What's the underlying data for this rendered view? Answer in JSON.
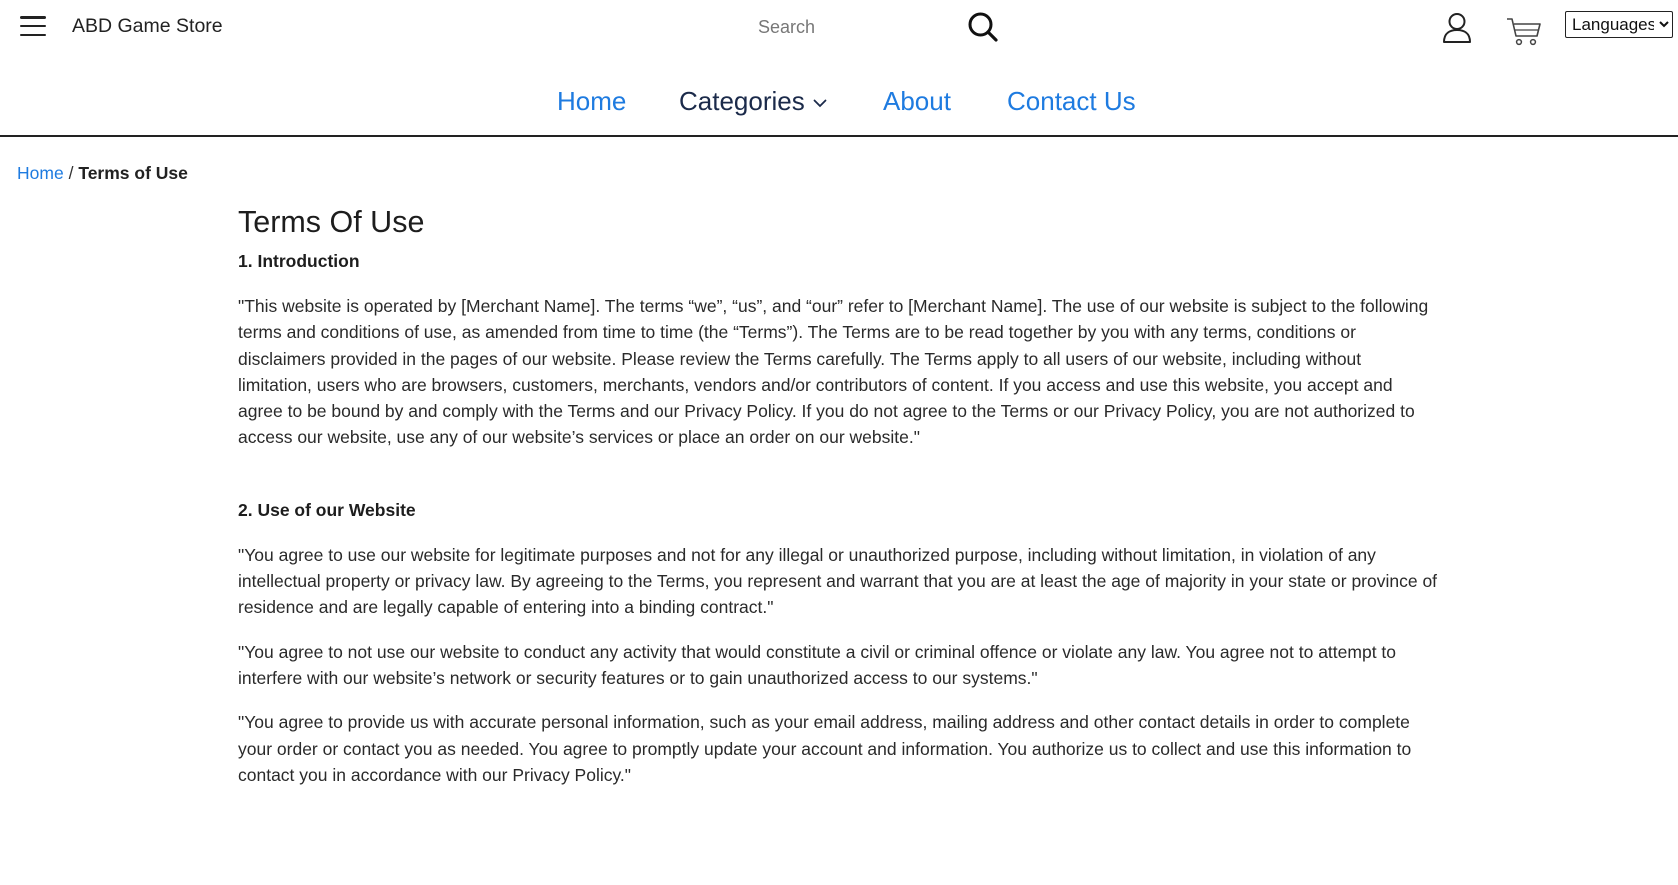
{
  "header": {
    "brand": "ABD Game Store",
    "search_placeholder": "Search",
    "language_label": "Languages"
  },
  "nav": {
    "home": "Home",
    "categories": "Categories",
    "about": "About",
    "contact": "Contact Us"
  },
  "breadcrumb": {
    "home": "Home",
    "separator": "/",
    "current": "Terms of Use"
  },
  "content": {
    "title": "Terms Of Use",
    "sections": [
      {
        "heading": "1. Introduction",
        "paragraphs": [
          "\"This website is operated by [Merchant Name]. The terms “we”, “us”, and “our” refer to [Merchant Name]. The use of our website is subject to the following terms and conditions of use, as amended from time to time (the “Terms”). The Terms are to be read together by you with any terms, conditions or disclaimers provided in the pages of our website. Please review the Terms carefully. The Terms apply to all users of our website, including without limitation, users who are browsers, customers, merchants, vendors and/or contributors of content. If you access and use this website, you accept and agree to be bound by and comply with the Terms and our Privacy Policy. If you do not agree to the Terms or our Privacy Policy, you are not authorized to access our website, use any of our website’s services or place an order on our website.\""
        ]
      },
      {
        "heading": "2. Use of our Website",
        "paragraphs": [
          "\"You agree to use our website for legitimate purposes and not for any illegal or unauthorized purpose, including without limitation, in violation of any intellectual property or privacy law. By agreeing to the Terms, you represent and warrant that you are at least the age of majority in your state or province of residence and are legally capable of entering into a binding contract.\"",
          "\"You agree to not use our website to conduct any activity that would constitute a civil or criminal offence or violate any law. You agree not to attempt to interfere with our website’s network or security features or to gain unauthorized access to our systems.\"",
          "\"You agree to provide us with accurate personal information, such as your email address, mailing address and other contact details in order to complete your order or contact you as needed. You agree to promptly update your account and information. You authorize us to collect and use this information to contact you in accordance with our Privacy Policy.\""
        ]
      }
    ]
  },
  "colors": {
    "link": "#1e7be0",
    "text": "#222222",
    "nav_dark": "#1b2a4a"
  },
  "icons": [
    "hamburger-menu-icon",
    "search-icon",
    "user-icon",
    "cart-icon",
    "chevron-down-icon"
  ]
}
